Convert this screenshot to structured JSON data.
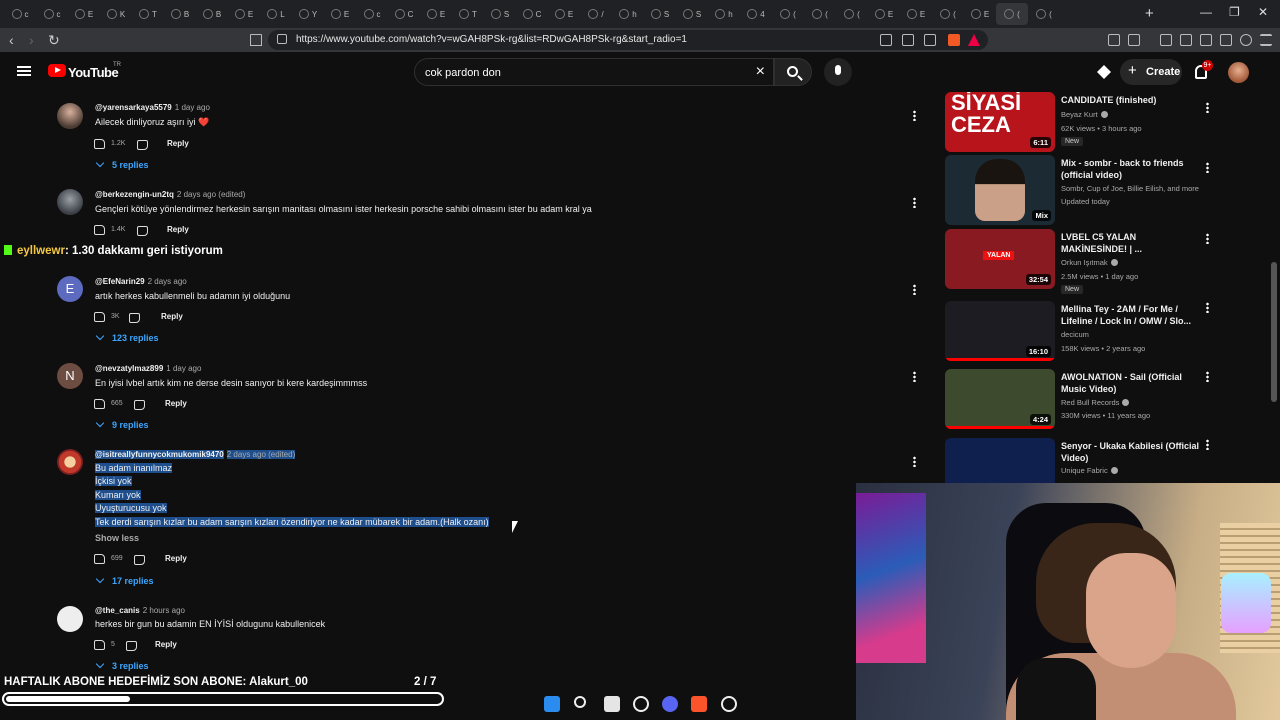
{
  "browser": {
    "tabs": [
      {
        "label": "c"
      },
      {
        "label": "c"
      },
      {
        "label": "E"
      },
      {
        "label": "K"
      },
      {
        "label": "T"
      },
      {
        "label": "B"
      },
      {
        "label": "B"
      },
      {
        "label": "E"
      },
      {
        "label": "L"
      },
      {
        "label": "Y"
      },
      {
        "label": "E"
      },
      {
        "label": "c"
      },
      {
        "label": "C"
      },
      {
        "label": "E"
      },
      {
        "label": "T"
      },
      {
        "label": "S"
      },
      {
        "label": "C"
      },
      {
        "label": "E"
      },
      {
        "label": "/"
      },
      {
        "label": "h"
      },
      {
        "label": "S"
      },
      {
        "label": "S"
      },
      {
        "label": "h"
      },
      {
        "label": "4"
      },
      {
        "label": "("
      },
      {
        "label": "("
      },
      {
        "label": "("
      },
      {
        "label": "E"
      },
      {
        "label": "E"
      },
      {
        "label": "("
      },
      {
        "label": "E"
      },
      {
        "label": "("
      },
      {
        "label": "("
      }
    ],
    "new_tab": "+",
    "url": "https://www.youtube.com/watch?v=wGAH8PSk-rg&list=RDwGAH8PSk-rg&start_radio=1"
  },
  "header": {
    "logo_text": "YouTube",
    "country_code": "TR",
    "search_value": "cok pardon don",
    "create_label": "Create",
    "notification_count": "9+",
    "icons": {
      "menu": "hamburger-icon",
      "search": "search-icon",
      "mic": "mic-icon",
      "bell": "bell-icon"
    }
  },
  "comments": [
    {
      "author": "@yarensarkaya5579",
      "time": "1 day ago",
      "lines": [
        "Ailecek dinliyoruz aşırı iyi ❤️"
      ],
      "likes": "1.2K",
      "reply_label": "Reply",
      "replies": "5 replies"
    },
    {
      "author": "@berkezengin-un2tq",
      "time": "2 days ago (edited)",
      "lines": [
        "Gençleri kötüye yönlendirmez herkesin sarışın manitası olmasını ister herkesin porsche sahibi olmasını ister bu adam kral ya"
      ],
      "likes": "1.4K",
      "reply_label": "Reply",
      "replies": ""
    },
    {
      "author": "@EfeNarin29",
      "time": "2 days ago",
      "avatar_letter": "E",
      "lines": [
        "artık herkes kabullenmeli bu adamın iyi olduğunu"
      ],
      "likes": "3K",
      "reply_label": "Reply",
      "replies": "123 replies"
    },
    {
      "author": "@nevzatylmaz899",
      "time": "1 day ago",
      "avatar_letter": "N",
      "lines": [
        "En iyisi lvbel artık kim ne derse desin sanıyor bi kere kardeşimmmss"
      ],
      "likes": "665",
      "reply_label": "Reply",
      "replies": "9 replies"
    },
    {
      "author": "@isitreallyfunnycokmukomik9470",
      "time": "2 days ago (edited)",
      "lines": [
        "Bu adam inanılmaz",
        "İçkisi yok",
        "Kumarı yok",
        "Uyuşturucusu yok",
        "Tek derdi sarışın kızlar bu adam sarışın kızları özendiriyor ne kadar mübarek bir adam.(Halk ozanı)"
      ],
      "show_less": "Show less",
      "likes": "699",
      "reply_label": "Reply",
      "replies": "17 replies"
    },
    {
      "author": "@the_canis",
      "time": "2 hours ago",
      "lines": [
        "herkes bir gun bu adamin EN İYİSİ oldugunu kabullenicek"
      ],
      "likes": "5",
      "reply_label": "Reply",
      "replies": "3 replies"
    }
  ],
  "chat_overlay": {
    "user": "eyllwewr",
    "message": ": 1.30 dakkamı geri istiyorum"
  },
  "sub_goal": {
    "text": "HAFTALIK ABONE HEDEFİMİZ SON ABONE: Alakurt_00",
    "count": "2 / 7",
    "progress": 0.285
  },
  "sidebar": [
    {
      "title": "CANDIDATE (finished)",
      "channel": "Beyaz Kurt",
      "verified": true,
      "meta": "62K views • 3 hours ago",
      "badge": "New",
      "duration": "6:11",
      "thumb_text": "SİYASİ CEZA",
      "thumb_bg": "#b8141c"
    },
    {
      "title": "Mix - sombr - back to friends (official video)",
      "channel": "Sombr, Cup of Joe, Billie Eilish, and more",
      "verified": false,
      "meta": "Updated today",
      "badge": "",
      "duration": "Mix",
      "thumb_text": "",
      "thumb_bg": "#1b2a33"
    },
    {
      "title": "LVBEL C5 YALAN MAKİNESİNDE! | ...",
      "channel": "Orkun Işıtmak",
      "verified": true,
      "meta": "2.5M views • 1 day ago",
      "badge": "New",
      "duration": "32:54",
      "thumb_text": "YALAN",
      "thumb_bg": "#8a1a22"
    },
    {
      "title": "Mellina Tey - 2AM / For Me / Lifeline / Lock In / OMW / Slo...",
      "channel": "decicum",
      "verified": false,
      "meta": "158K views • 2 years ago",
      "badge": "",
      "duration": "16:10",
      "thumb_text": "",
      "thumb_bg": "#1c1c22",
      "watched": 1.0
    },
    {
      "title": "AWOLNATION - Sail (Official Music Video)",
      "channel": "Red Bull Records",
      "verified": true,
      "meta": "330M views • 11 years ago",
      "badge": "",
      "duration": "4:24",
      "thumb_text": "",
      "thumb_bg": "#3e4a2e",
      "watched": 1.0
    },
    {
      "title": "Senyor - Ukaka Kabilesi (Official Video)",
      "channel": "Unique Fabric",
      "verified": true,
      "meta": "",
      "badge": "",
      "duration": "",
      "thumb_text": "",
      "thumb_bg": "#10204e"
    }
  ]
}
